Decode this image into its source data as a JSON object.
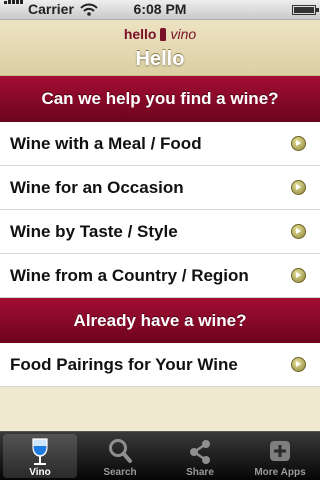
{
  "status_bar": {
    "carrier": "Carrier",
    "time": "6:08 PM"
  },
  "header": {
    "logo_hello": "hello",
    "logo_vino": "vino",
    "title": "Hello"
  },
  "sections": [
    {
      "header": "Can we help you find a wine?",
      "items": [
        {
          "label": "Wine with a Meal / Food"
        },
        {
          "label": "Wine for an Occasion"
        },
        {
          "label": "Wine by Taste / Style"
        },
        {
          "label": "Wine from a Country / Region"
        }
      ]
    },
    {
      "header": "Already have a wine?",
      "items": [
        {
          "label": "Food Pairings for Your Wine"
        }
      ]
    }
  ],
  "tab_bar": {
    "tabs": [
      {
        "label": "Vino",
        "icon": "wine-glass-icon",
        "selected": true
      },
      {
        "label": "Search",
        "icon": "magnifier-icon",
        "selected": false
      },
      {
        "label": "Share",
        "icon": "share-icon",
        "selected": false
      },
      {
        "label": "More Apps",
        "icon": "more-apps-icon",
        "selected": false
      }
    ]
  },
  "colors": {
    "accent_wine": "#8c0a2b",
    "header_cream": "#e3d9b2",
    "chevron_olive": "#9a9242"
  }
}
